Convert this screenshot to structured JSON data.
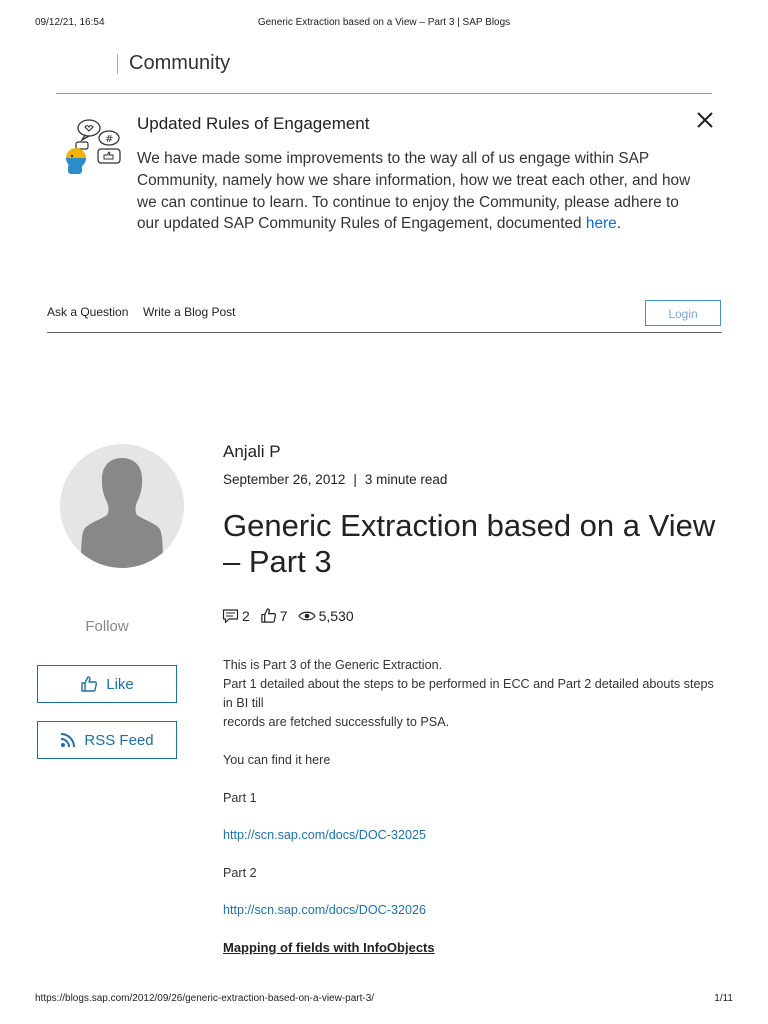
{
  "print_header": {
    "datetime": "09/12/21, 16:54",
    "page_title": "Generic Extraction based on a View – Part 3 | SAP Blogs"
  },
  "site": {
    "section": "Community"
  },
  "engagement": {
    "title": "Updated Rules of Engagement",
    "text": "We have made some improvements to the way all of us engage within SAP Community, namely how we share information, how we treat each other, and how we can continue to learn. To continue to enjoy the Community, please adhere to our updated SAP Community Rules of Engagement, documented",
    "link_label": "here",
    "trailing": "."
  },
  "nav": {
    "ask_question": "Ask a Question",
    "write_blog": "Write a Blog Post",
    "login": "Login"
  },
  "sidebar": {
    "follow": "Follow",
    "like": "Like",
    "rss": "RSS Feed"
  },
  "post": {
    "author": "Anjali P",
    "date": "September 26, 2012",
    "separator": "|",
    "read_time": "3 minute read",
    "title": "Generic Extraction based on a View – Part 3",
    "comments": "2",
    "likes": "7",
    "views": "5,530",
    "body": {
      "line1": "This is Part 3 of the Generic Extraction.",
      "line2": "Part 1 detailed about the steps to be performed in ECC and Part 2 detailed abouts steps in BI till",
      "line3": "records are fetched successfully to PSA.",
      "find": "You can find it here",
      "part1_label": "Part 1",
      "part1_link": "http://scn.sap.com/docs/DOC-32025",
      "part2_label": "Part 2",
      "part2_link": "http://scn.sap.com/docs/DOC-32026",
      "heading": "Mapping of fields with InfoObjects"
    }
  },
  "print_footer": {
    "url": "https://blogs.sap.com/2012/09/26/generic-extraction-based-on-a-view-part-3/",
    "page": "1/11"
  },
  "colors": {
    "link": "#0a6ed1",
    "button_border": "#1f6fa8",
    "avatar_bg": "#e5e5e5",
    "avatar_figure": "#888888"
  },
  "icons": [
    "close-icon",
    "engagement-illustration-icon",
    "thumbs-up-icon",
    "rss-icon",
    "comment-icon",
    "eye-icon",
    "avatar-silhouette-icon"
  ]
}
